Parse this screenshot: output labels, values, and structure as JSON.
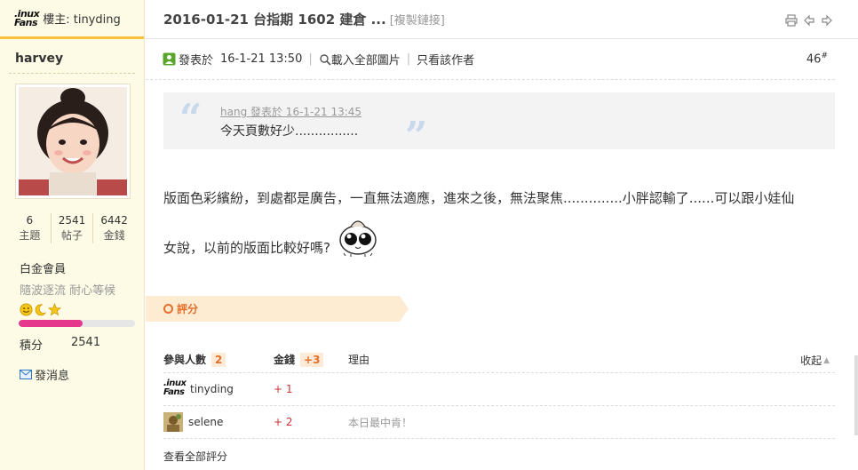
{
  "sidebar": {
    "op_logo_text": ".inux Fans",
    "op_label": "樓主: tinyding",
    "username": "harvey",
    "stats": [
      {
        "value": "6",
        "label": "主題"
      },
      {
        "value": "2541",
        "label": "帖子"
      },
      {
        "value": "6442",
        "label": "金錢"
      }
    ],
    "rank": "白金會員",
    "motto": "隨波逐流 耐心等候",
    "rank_icons": [
      "smile-icon",
      "moon-icon",
      "star-icon"
    ],
    "progress_fraction": 0.55,
    "credit_label": "積分",
    "credit_value": "2541",
    "pm_label": "發消息"
  },
  "header": {
    "title": "2016-01-21 台指期 1602 建倉 ...",
    "copy_link": "[複製鏈接]",
    "icons": [
      "print-icon",
      "prev-thread-icon",
      "next-thread-icon"
    ]
  },
  "post": {
    "posted_label": "發表於",
    "posted_time": "16-1-21 13:50",
    "load_images": "載入全部圖片",
    "author_only": "只看該作者",
    "floor_number": "46",
    "floor_mark": "#",
    "quote": {
      "author_line": "hang 發表於 16-1-21 13:45",
      "text": "今天頁數好少................"
    },
    "body_line1": "版面色彩繽紛，到處都是廣告，一直無法適應，進來之後，無法聚焦..............小胖認輸了......可以跟小娃仙",
    "body_line2": "女說，以前的版面比較好嗎?"
  },
  "rating": {
    "label": "評分",
    "col_participants": "參與人數",
    "participants_count": "2",
    "col_money": "金錢",
    "money_total": "+3",
    "col_reason": "理由",
    "collapse": "收起",
    "rows": [
      {
        "name": "tinyding",
        "score": "+ 1",
        "reason": ""
      },
      {
        "name": "selene",
        "score": "+ 2",
        "reason": "本日最中肯！"
      }
    ],
    "view_all": "查看全部評分"
  },
  "colors": {
    "sidebar_bg": "#fdfbe6",
    "accent_orange": "#e56f2b",
    "header_rule": "#f7c03d",
    "progress_pink": "#e5388d"
  }
}
